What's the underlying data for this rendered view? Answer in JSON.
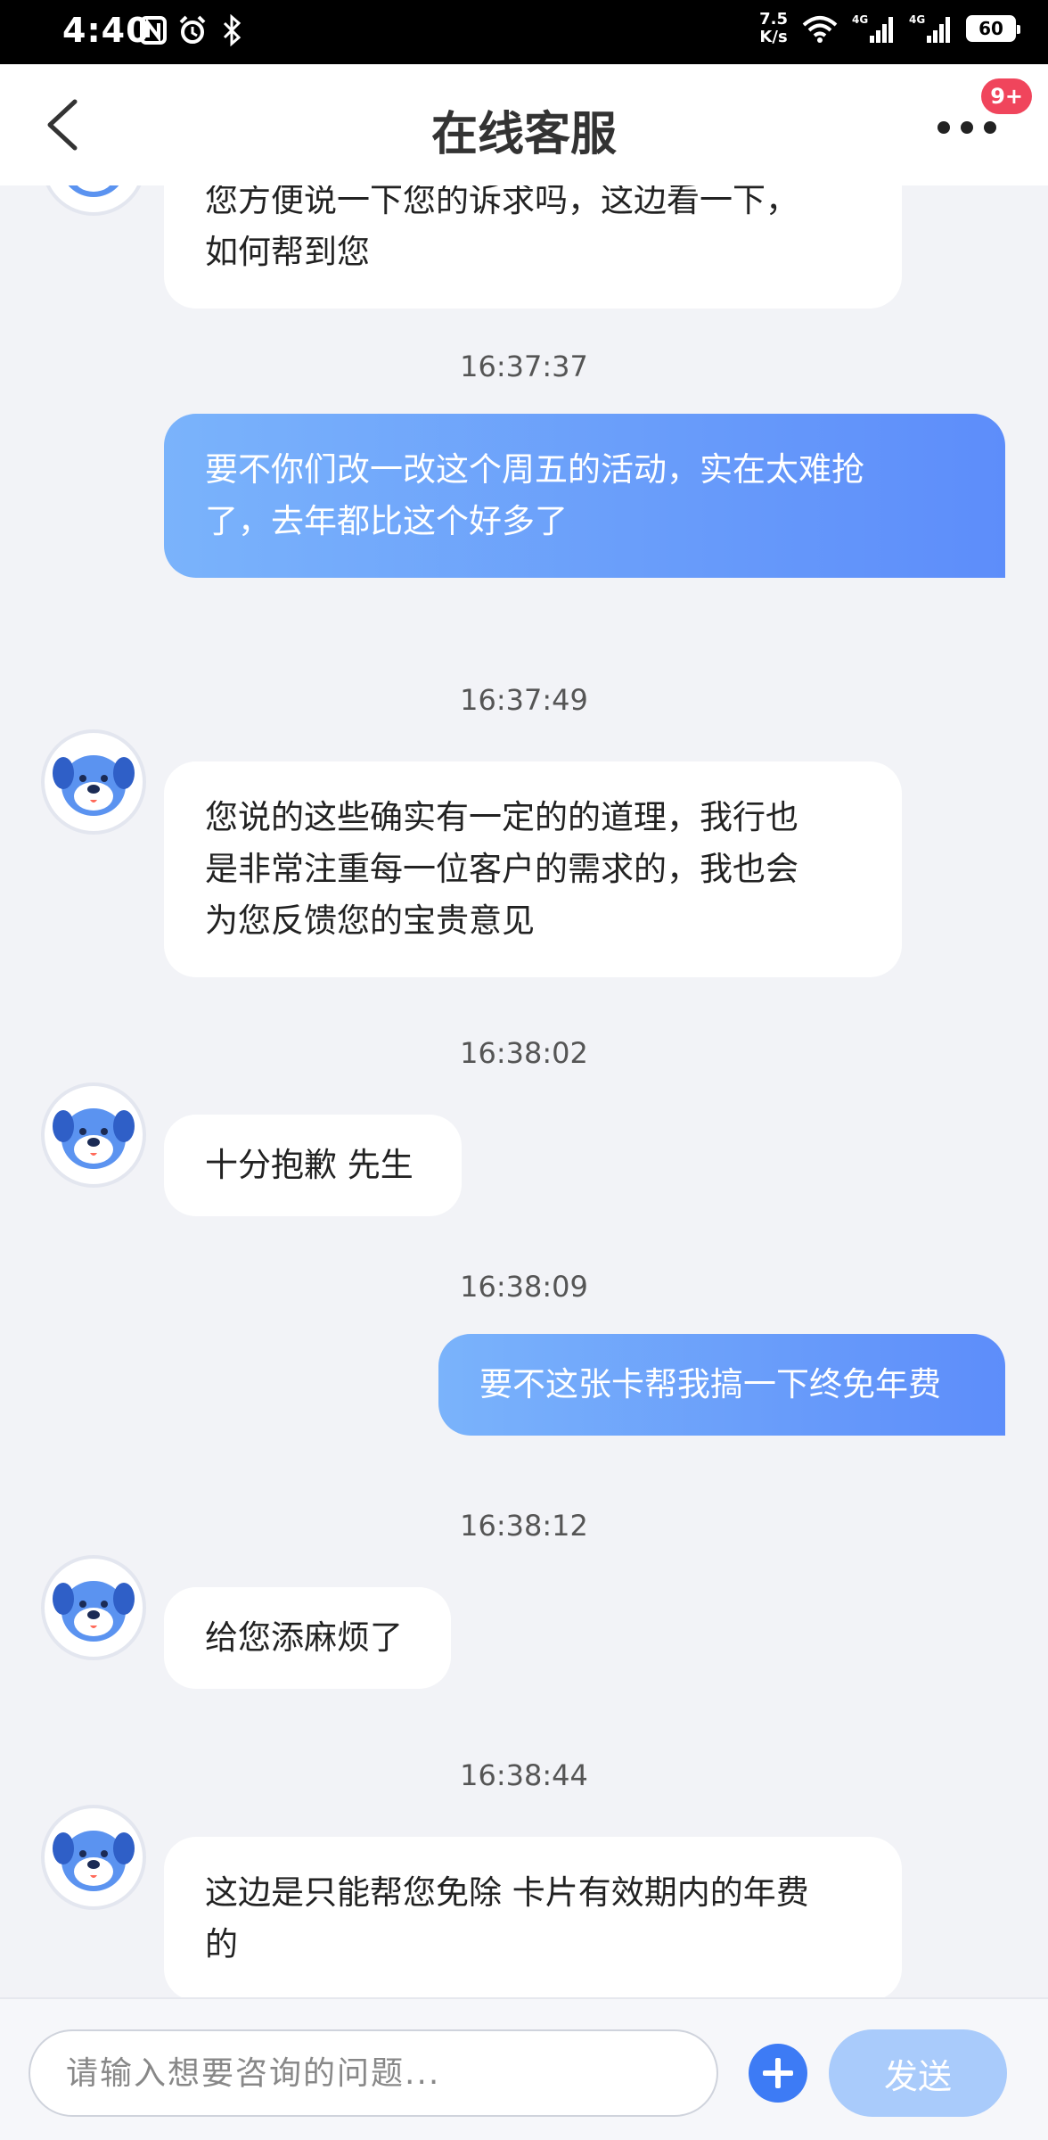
{
  "status_bar": {
    "time": "4:40",
    "net_speed_value": "7.5",
    "net_speed_unit": "K/s",
    "battery": "60"
  },
  "header": {
    "title": "在线客服",
    "badge": "9+"
  },
  "messages": {
    "agent_1": {
      "line1": "您方便说一下您的诉求吗，这边看一下，",
      "line2": "如何帮到您"
    },
    "ts_1": "16:37:37",
    "user_1": {
      "line1": "要不你们改一改这个周五的活动，实在太难抢",
      "line2": "了，去年都比这个好多了"
    },
    "ts_2": "16:37:49",
    "agent_2": {
      "line1": "您说的这些确实有一定的的道理，我行也",
      "line2": "是非常注重每一位客户的需求的，我也会",
      "line3": "为您反馈您的宝贵意见"
    },
    "ts_3": "16:38:02",
    "agent_3": "十分抱歉 先生",
    "ts_4": "16:38:09",
    "user_2": "要不这张卡帮我搞一下终免年费",
    "ts_5": "16:38:12",
    "agent_4": "给您添麻烦了",
    "ts_6": "16:38:44",
    "agent_5": {
      "line1": "这边是只能帮您免除 卡片有效期内的年费",
      "line2": "的"
    }
  },
  "input": {
    "placeholder": "请输入想要咨询的问题...",
    "send_label": "发送"
  },
  "colors": {
    "accent": "#3d7bf5",
    "user_bubble_start": "#7ab3fb",
    "user_bubble_end": "#5d8dfa",
    "send_disabled": "#a9cbfb",
    "badge": "#f0455c"
  }
}
